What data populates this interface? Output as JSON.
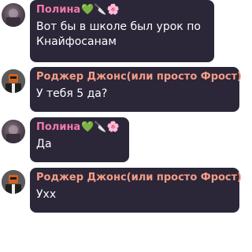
{
  "messages": [
    {
      "author": "Полина",
      "badges": "💚🔪🌸",
      "text_lines": [
        "Вот бы в школе был урок по",
        "Кнайфосанам"
      ]
    },
    {
      "author": "Роджер Джонс(или просто Фрост)",
      "badges": "",
      "text_lines": [
        "У тебя 5 да?"
      ]
    },
    {
      "author": "Полина",
      "badges": "💚🔪🌸",
      "text_lines": [
        "Да"
      ]
    },
    {
      "author": "Роджер Джонс(или просто Фрост)",
      "badges": "",
      "text_lines": [
        "Ухх"
      ]
    }
  ],
  "colors": {
    "bubble": "#2b2638",
    "polina_name": "#f27aa8",
    "roger_name": "#f49c86",
    "text": "#ffffff"
  },
  "icons": {
    "polina_avatar": "polina-avatar-icon",
    "roger_avatar": "roger-avatar-icon"
  }
}
